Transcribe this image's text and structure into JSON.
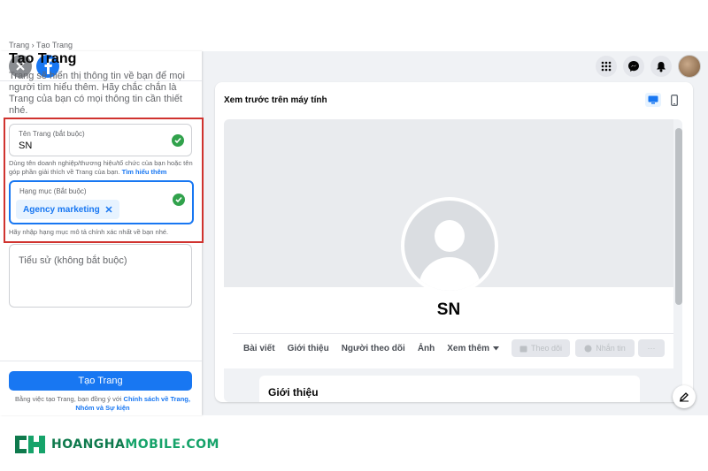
{
  "left_panel": {
    "breadcrumb": "Trang › Tạo Trang",
    "title": "Tạo Trang",
    "description": "Trang sẽ hiển thị thông tin về bạn để mọi người tìm hiểu thêm. Hãy chắc chắn là Trang của bạn có mọi thông tin cần thiết nhé.",
    "page_name_field": {
      "label": "Tên Trang (bắt buộc)",
      "value": "SN",
      "help": "Dùng tên doanh nghiệp/thương hiệu/tổ chức của bạn hoặc tên góp phần giải thích về Trang của bạn.",
      "help_link": "Tìm hiểu thêm"
    },
    "category_field": {
      "label": "Hạng mục (Bắt buộc)",
      "chip": "Agency marketing",
      "help": "Hãy nhập hạng mục mô tả chính xác nhất về bạn nhé."
    },
    "bio_field": {
      "placeholder": "Tiểu sử (không bắt buộc)"
    },
    "create_button": "Tạo Trang",
    "terms_prefix": "Bằng việc tạo Trang, bạn đồng ý với",
    "terms_link": "Chính sách về Trang, Nhóm và Sự kiện"
  },
  "top_icons": [
    "grid-icon",
    "messenger-icon",
    "bell-icon",
    "avatar"
  ],
  "preview": {
    "title": "Xem trước trên máy tính",
    "page_name": "SN",
    "tabs": [
      "Bài viết",
      "Giới thiệu",
      "Người theo dõi",
      "Ảnh",
      "Xem thêm"
    ],
    "follow_button": "Theo dõi",
    "message_button": "Nhắn tin",
    "more_button": "···",
    "about_title": "Giới thiệu"
  },
  "watermark": {
    "brand_a": "HOANGHA",
    "brand_b": "MOBILE.COM"
  },
  "colors": {
    "accent": "#1877f2",
    "success": "#31a24c",
    "highlight_border": "#d0332f",
    "watermark": "#0f7a4d"
  }
}
